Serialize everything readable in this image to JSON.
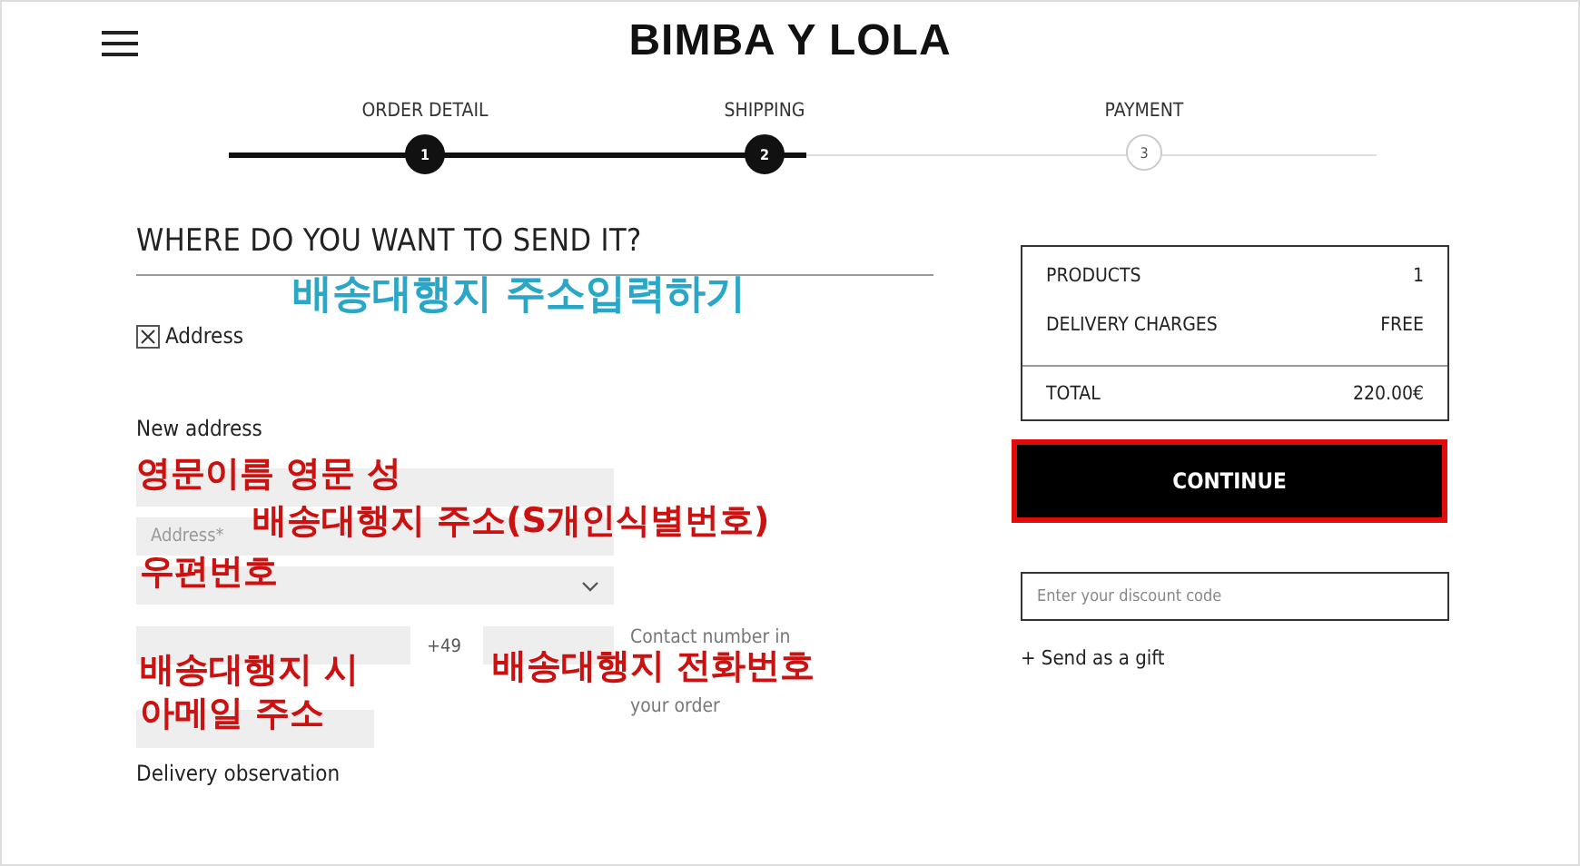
{
  "header": {
    "logo": "BIMBA Y LOLA"
  },
  "steps": [
    {
      "label": "ORDER DETAIL",
      "number": "1",
      "done": true
    },
    {
      "label": "SHIPPING",
      "number": "2",
      "done": true
    },
    {
      "label": "PAYMENT",
      "number": "3",
      "done": false
    }
  ],
  "form": {
    "title": "WHERE DO YOU WANT TO SEND IT?",
    "address_option": {
      "label": "Address",
      "checked": true
    },
    "section_label": "New address",
    "address_placeholder": "Address*",
    "phone_prefix": "+49",
    "phone_note": [
      "Contact number in",
      "your order"
    ],
    "delivery_label": "Delivery observation"
  },
  "annotations": [
    {
      "text": "배송대행지 주소입력하기",
      "color": "#2aa7c6"
    },
    {
      "text": "영문이름 영문 성",
      "color": "#cc1111"
    },
    {
      "text": "배송대행지 주소(S개인식별번호)",
      "color": "#cc1111"
    },
    {
      "text": "우편번호",
      "color": "#cc1111"
    },
    {
      "text": "배송대행지 시",
      "color": "#cc1111"
    },
    {
      "text": "배송대행지 전화번호",
      "color": "#cc1111"
    },
    {
      "text": "아메일 주소",
      "color": "#cc1111"
    }
  ],
  "summary": {
    "rows": [
      {
        "label": "PRODUCTS",
        "value": "1"
      },
      {
        "label": "DELIVERY CHARGES",
        "value": "FREE"
      }
    ],
    "total": {
      "label": "TOTAL",
      "value": "220.00€"
    }
  },
  "continue_button": {
    "label": "CONTINUE",
    "highlighted": true
  },
  "discount": {
    "placeholder": "Enter your discount code"
  },
  "gift_link": "+ Send as a gift"
}
